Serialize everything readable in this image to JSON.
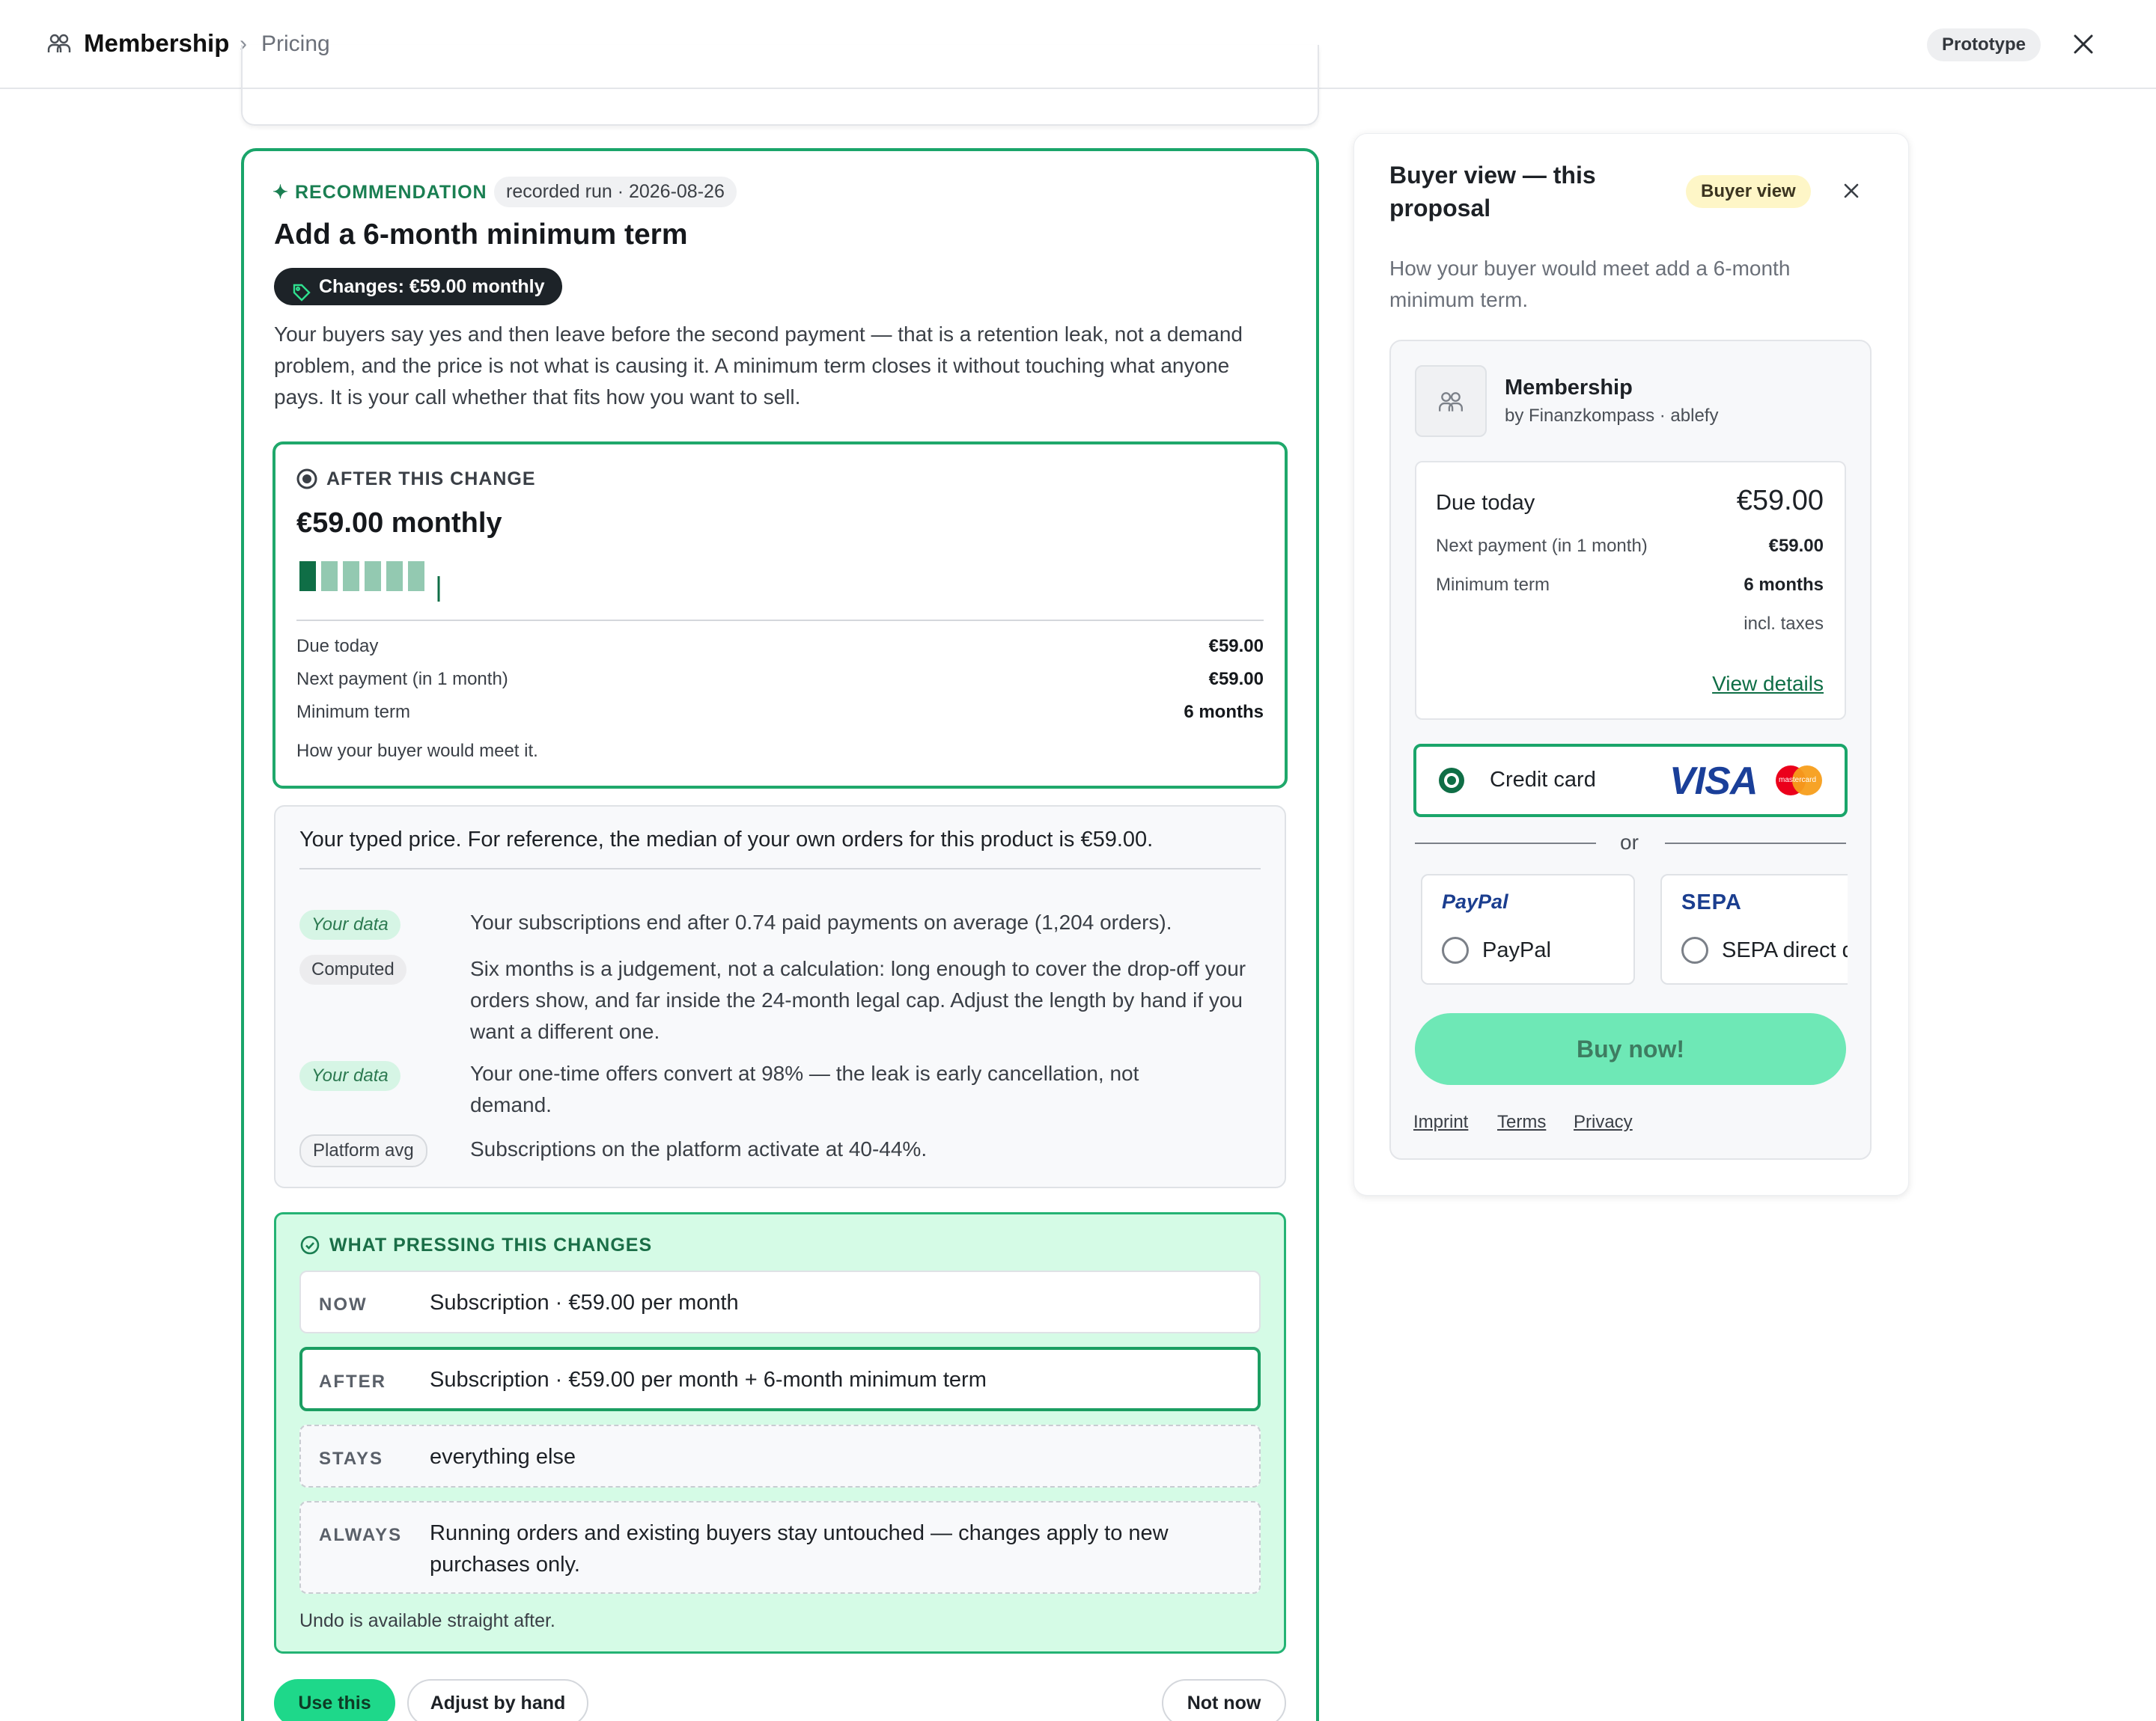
{
  "header": {
    "title": "Membership",
    "separator": "›",
    "subtitle": "Pricing",
    "badge": "Prototype"
  },
  "recommendation": {
    "label": "RECOMMENDATION",
    "spark": "✦",
    "run": "recorded run · 2026-08-26",
    "title": "Add a 6-month minimum term",
    "change_pill": "Changes: €59.00 monthly",
    "body": "Your buyers say yes and then leave before the second payment — that is a retention leak, not a demand problem, and the price is not what is causing it. A minimum term closes it without touching what anyone pays. It is your call whether that fits how you want to sell."
  },
  "after_change": {
    "label": "AFTER THIS CHANGE",
    "price": "€59.00 monthly",
    "bars": [
      1,
      1,
      1,
      1,
      1,
      1
    ],
    "rows": [
      {
        "label": "Due today",
        "value": "€59.00"
      },
      {
        "label": "Next payment (in 1 month)",
        "value": "€59.00"
      },
      {
        "label": "Minimum term",
        "value": "6 months"
      }
    ],
    "footnote": "How your buyer would meet it."
  },
  "evidence": {
    "intro": "Your typed price. For reference, the median of your own orders for this product is €59.00.",
    "items": [
      {
        "tag": "Your data",
        "text": "Your subscriptions end after 0.74 paid payments on average (1,204 orders)."
      },
      {
        "tag": "Computed",
        "text": "Six months is a judgement, not a calculation: long enough to cover the drop-off your orders show, and far inside the 24-month legal cap. Adjust the length by hand if you want a different one."
      },
      {
        "tag": "Your data",
        "text": "Your one-time offers convert at 98% — the leak is early cancellation, not demand."
      },
      {
        "tag": "Platform avg",
        "text": "Subscriptions on the platform activate at 40-44%."
      }
    ]
  },
  "changes": {
    "label": "WHAT PRESSING THIS CHANGES",
    "rows": [
      {
        "key": "NOW",
        "value": "Subscription · €59.00 per month"
      },
      {
        "key": "AFTER",
        "value": "Subscription · €59.00 per month + 6-month minimum term"
      },
      {
        "key": "STAYS",
        "value": "everything else"
      },
      {
        "key": "ALWAYS",
        "value": "Running orders and existing buyers stay untouched — changes apply to new purchases only."
      }
    ],
    "footnote": "Undo is available straight after."
  },
  "actions": {
    "use": "Use this",
    "adjust": "Adjust by hand",
    "not_now": "Not now"
  },
  "buyer_view": {
    "title": "Buyer view — this proposal",
    "badge": "Buyer view",
    "subtitle": "How your buyer would meet add a 6-month minimum term.",
    "product_name": "Membership",
    "product_by": "by Finanzkompass · ablefy",
    "due_label": "Due today",
    "due_value": "€59.00",
    "next_label": "Next payment (in 1 month)",
    "next_value": "€59.00",
    "term_label": "Minimum term",
    "term_value": "6 months",
    "taxes": "incl. taxes",
    "details_link": "View details",
    "credit_card": "Credit card",
    "visa": "VISA",
    "mastercard": "mastercard",
    "or": "or",
    "paypal_logo": "PayPal",
    "paypal": "PayPal",
    "sepa_logo": "SEPA",
    "sepa": "SEPA direct debit",
    "buy": "Buy now!",
    "footer": [
      "Imprint",
      "Terms",
      "Privacy"
    ]
  },
  "colors": {
    "accent_green": "#1aa56a",
    "dark_green": "#0f6e46",
    "changes_bg": "#d5fbe6",
    "buy_button": "#6ee8b6"
  }
}
